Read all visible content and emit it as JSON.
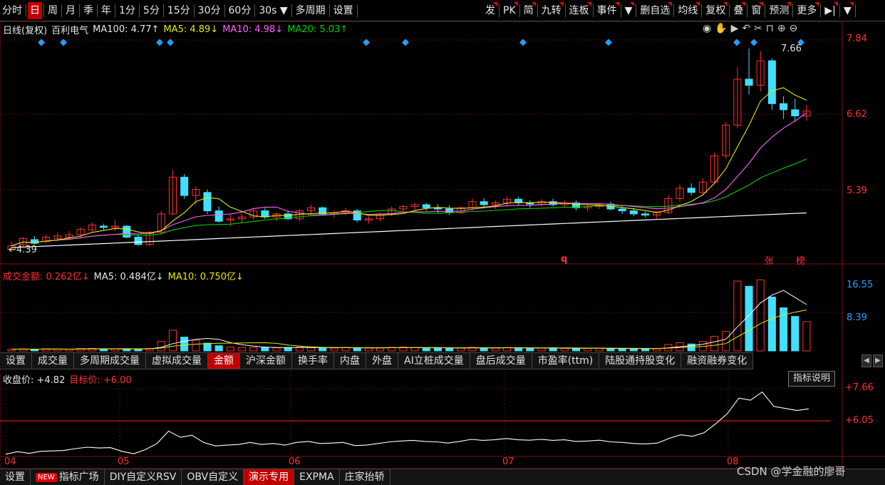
{
  "toolbar": {
    "left_items": [
      {
        "label": "分时",
        "active": false
      },
      {
        "label": "日",
        "active": true
      },
      {
        "label": "周",
        "active": false
      },
      {
        "label": "月",
        "active": false
      },
      {
        "label": "季",
        "active": false
      },
      {
        "label": "年",
        "active": false
      },
      {
        "label": "1分",
        "active": false
      },
      {
        "label": "5分",
        "active": false
      },
      {
        "label": "15分",
        "active": false
      },
      {
        "label": "30分",
        "active": false
      },
      {
        "label": "60分",
        "active": false
      },
      {
        "label": "30s ▼",
        "active": false
      },
      {
        "label": "多周期",
        "active": false
      },
      {
        "label": "设置",
        "active": false
      }
    ],
    "right_items": [
      "发",
      "PK",
      "简",
      "九转",
      "连板",
      "事件",
      "▼",
      "删自选",
      "均线",
      "复权",
      "叠",
      "窗",
      "预测",
      "更多",
      "▶|",
      "▼"
    ]
  },
  "price_legend": {
    "period": "日线(复权)",
    "name": "百利电气",
    "ma100": "MA100: 4.77↑",
    "ma5": "MA5: 4.89↓",
    "ma10": "MA10: 4.98↓",
    "ma20": "MA20: 5.03↑"
  },
  "price_axis": [
    "7.84",
    "6.62",
    "5.39"
  ],
  "price_annotations": {
    "high": "7.66",
    "low": "4.39",
    "q": "q",
    "zhang": "张",
    "bang": "榜"
  },
  "volume_legend": {
    "amount": "成交金额: 0.262亿↓",
    "ma5": "MA5: 0.484亿↓",
    "ma10": "MA10: 0.750亿↓"
  },
  "volume_axis": [
    "16.55",
    "8.39"
  ],
  "indicator_tabs": [
    {
      "label": "设置",
      "active": false
    },
    {
      "label": "成交量",
      "active": false
    },
    {
      "label": "多周期成交量",
      "active": false
    },
    {
      "label": "虚拟成交量",
      "active": false
    },
    {
      "label": "金额",
      "active": true
    },
    {
      "label": "沪深金额",
      "active": false
    },
    {
      "label": "换手率",
      "active": false
    },
    {
      "label": "内盘",
      "active": false
    },
    {
      "label": "外盘",
      "active": false
    },
    {
      "label": "AI立桩成交量",
      "active": false
    },
    {
      "label": "盘后成交量",
      "active": false
    },
    {
      "label": "市盈率(ttm)",
      "active": false
    },
    {
      "label": "陆股通持股变化",
      "active": false
    },
    {
      "label": "融资融券变化",
      "active": false
    }
  ],
  "indicator": {
    "close_label": "收盘价: +4.82",
    "target_label": "目标价: +6.00",
    "help": "指标说明",
    "axis": [
      "+7.66",
      "+6.05"
    ]
  },
  "months": [
    "04",
    "05",
    "06",
    "07",
    "08"
  ],
  "bottom_bar": [
    {
      "label": "设置",
      "active": false,
      "badge": ""
    },
    {
      "label": "指标广场",
      "active": false,
      "badge": "NEW"
    },
    {
      "label": "DIY自定义RSV",
      "active": false,
      "badge": ""
    },
    {
      "label": "OBV自定义",
      "active": false,
      "badge": ""
    },
    {
      "label": "演示专用",
      "active": true,
      "badge": ""
    },
    {
      "label": "EXPMA",
      "active": false,
      "badge": ""
    },
    {
      "label": "庄家抬轿",
      "active": false,
      "badge": ""
    }
  ],
  "watermark": "CSDN @学金融的廖哥",
  "colors": {
    "up": "#ff3030",
    "down": "#40e0ff",
    "ma5": "#e8e800",
    "ma10": "#ff60ff",
    "ma20": "#00d000",
    "ma100": "#ffffff"
  },
  "chart_data": {
    "type": "candlestick",
    "ohlc": [
      [
        4.42,
        4.55,
        4.38,
        4.48
      ],
      [
        4.5,
        4.62,
        4.46,
        4.6
      ],
      [
        4.58,
        4.64,
        4.5,
        4.52
      ],
      [
        4.55,
        4.66,
        4.52,
        4.62
      ],
      [
        4.6,
        4.7,
        4.56,
        4.64
      ],
      [
        4.62,
        4.72,
        4.58,
        4.66
      ],
      [
        4.66,
        4.78,
        4.62,
        4.75
      ],
      [
        4.74,
        4.86,
        4.7,
        4.82
      ],
      [
        4.8,
        4.84,
        4.74,
        4.78
      ],
      [
        4.78,
        4.9,
        4.72,
        4.8
      ],
      [
        4.8,
        4.82,
        4.6,
        4.62
      ],
      [
        4.62,
        4.66,
        4.48,
        4.5
      ],
      [
        4.5,
        4.72,
        4.48,
        4.7
      ],
      [
        4.7,
        5.05,
        4.66,
        5.0
      ],
      [
        5.0,
        5.72,
        4.98,
        5.6
      ],
      [
        5.6,
        5.65,
        5.25,
        5.3
      ],
      [
        5.3,
        5.45,
        5.15,
        5.4
      ],
      [
        5.35,
        5.4,
        5.0,
        5.05
      ],
      [
        5.05,
        5.12,
        4.85,
        4.88
      ],
      [
        4.9,
        5.0,
        4.8,
        4.92
      ],
      [
        4.92,
        5.0,
        4.86,
        4.95
      ],
      [
        4.95,
        5.1,
        4.9,
        5.05
      ],
      [
        5.05,
        5.1,
        4.92,
        4.95
      ],
      [
        4.95,
        5.02,
        4.88,
        5.0
      ],
      [
        5.0,
        5.05,
        4.9,
        4.92
      ],
      [
        4.92,
        5.08,
        4.88,
        5.05
      ],
      [
        5.05,
        5.15,
        5.0,
        5.1
      ],
      [
        5.1,
        5.12,
        4.98,
        5.0
      ],
      [
        5.0,
        5.06,
        4.94,
        5.02
      ],
      [
        5.02,
        5.1,
        4.98,
        5.05
      ],
      [
        5.05,
        5.08,
        4.86,
        4.9
      ],
      [
        4.9,
        4.96,
        4.84,
        4.92
      ],
      [
        4.92,
        5.02,
        4.88,
        5.0
      ],
      [
        5.0,
        5.12,
        4.96,
        5.08
      ],
      [
        5.08,
        5.15,
        5.02,
        5.12
      ],
      [
        5.12,
        5.18,
        5.06,
        5.15
      ],
      [
        5.15,
        5.18,
        5.05,
        5.1
      ],
      [
        5.1,
        5.16,
        5.02,
        5.08
      ],
      [
        5.08,
        5.14,
        4.98,
        5.02
      ],
      [
        5.02,
        5.12,
        5.0,
        5.1
      ],
      [
        5.1,
        5.25,
        5.06,
        5.2
      ],
      [
        5.2,
        5.26,
        5.1,
        5.15
      ],
      [
        5.15,
        5.22,
        5.08,
        5.18
      ],
      [
        5.18,
        5.28,
        5.12,
        5.24
      ],
      [
        5.24,
        5.28,
        5.14,
        5.18
      ],
      [
        5.18,
        5.22,
        5.1,
        5.16
      ],
      [
        5.16,
        5.24,
        5.12,
        5.2
      ],
      [
        5.2,
        5.25,
        5.12,
        5.15
      ],
      [
        5.15,
        5.22,
        5.1,
        5.18
      ],
      [
        5.18,
        5.22,
        5.06,
        5.1
      ],
      [
        5.1,
        5.16,
        5.04,
        5.12
      ],
      [
        5.12,
        5.18,
        5.08,
        5.16
      ],
      [
        5.16,
        5.2,
        5.06,
        5.08
      ],
      [
        5.08,
        5.14,
        5.0,
        5.05
      ],
      [
        5.05,
        5.1,
        4.96,
        5.0
      ],
      [
        5.0,
        5.04,
        4.94,
        4.98
      ],
      [
        4.98,
        5.04,
        4.92,
        5.02
      ],
      [
        5.02,
        5.3,
        5.0,
        5.25
      ],
      [
        5.25,
        5.48,
        5.2,
        5.42
      ],
      [
        5.42,
        5.5,
        5.3,
        5.35
      ],
      [
        5.35,
        5.58,
        5.3,
        5.52
      ],
      [
        5.52,
        6.0,
        5.5,
        5.95
      ],
      [
        5.95,
        6.5,
        5.9,
        6.45
      ],
      [
        6.45,
        7.4,
        6.4,
        7.2
      ],
      [
        7.2,
        7.7,
        6.95,
        7.1
      ],
      [
        7.1,
        7.66,
        7.0,
        7.5
      ],
      [
        7.5,
        7.54,
        6.7,
        6.8
      ],
      [
        6.8,
        6.92,
        6.55,
        6.7
      ],
      [
        6.7,
        6.88,
        6.5,
        6.6
      ],
      [
        6.6,
        6.78,
        6.52,
        6.68
      ]
    ],
    "volume": [
      0.4,
      0.45,
      0.35,
      0.5,
      0.42,
      0.38,
      0.55,
      0.6,
      0.48,
      0.5,
      0.45,
      0.4,
      0.6,
      2.2,
      4.8,
      3.2,
      2.5,
      1.8,
      1.2,
      0.9,
      0.85,
      0.8,
      0.75,
      0.7,
      0.8,
      0.9,
      0.75,
      0.7,
      0.65,
      0.8,
      0.7,
      0.65,
      0.7,
      0.85,
      0.9,
      0.75,
      0.7,
      0.65,
      0.6,
      0.7,
      0.85,
      0.7,
      0.65,
      0.8,
      0.7,
      0.6,
      0.65,
      0.7,
      0.6,
      0.55,
      0.6,
      0.65,
      0.55,
      0.5,
      0.5,
      0.45,
      0.55,
      1.5,
      1.9,
      1.6,
      2.2,
      3.4,
      4.5,
      16.2,
      15.0,
      16.5,
      12.5,
      10.0,
      8.0,
      6.8
    ],
    "ylim": [
      4.3,
      7.84
    ],
    "volume_ylim": [
      0,
      16.55
    ]
  }
}
